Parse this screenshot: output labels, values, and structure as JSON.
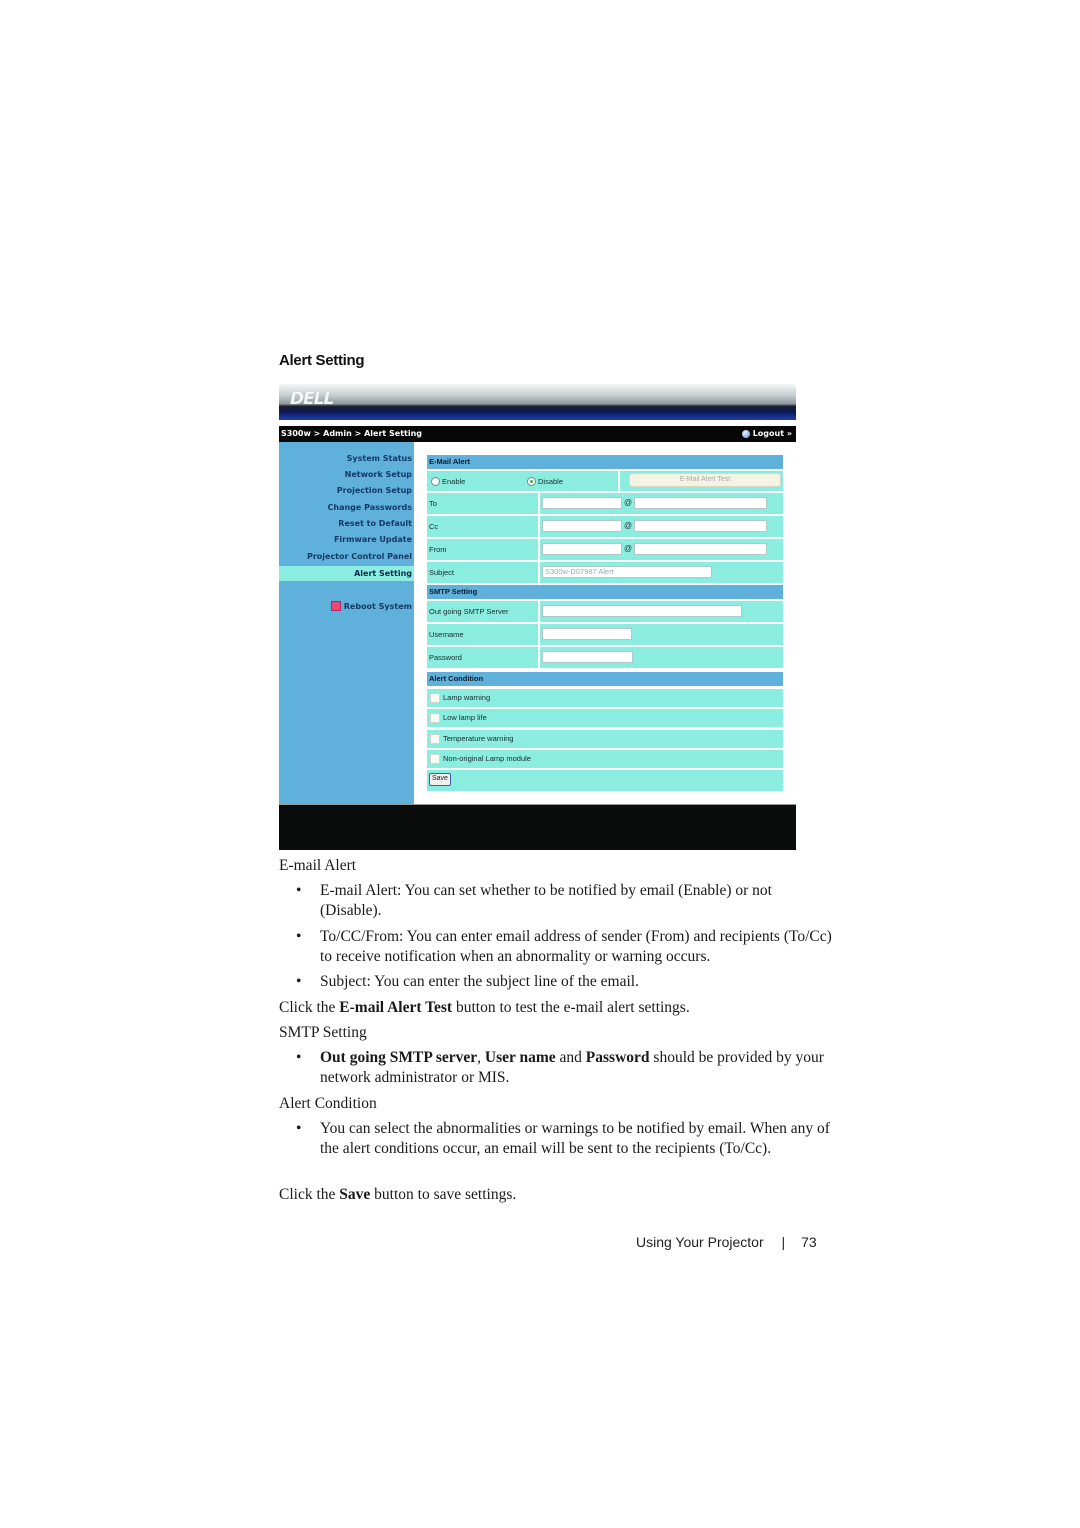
{
  "section_title": "Alert Setting",
  "ui": {
    "logo": "DELL",
    "breadcrumb": "S300w > Admin > Alert Setting",
    "logout": "Logout »",
    "sidebar": [
      "System Status",
      "Network Setup",
      "Projection Setup",
      "Change Passwords",
      "Reset to Default",
      "Firmware Update",
      "Projector Control Panel",
      "Alert Setting"
    ],
    "active_item": "Alert Setting",
    "reboot": "Reboot System",
    "email_alert": {
      "header": "E-Mail Alert",
      "enable_label": "Enable",
      "disable_label": "Disable",
      "selected": "Disable",
      "test_button": "E-Mail Alert Test",
      "to_label": "To",
      "cc_label": "Cc",
      "from_label": "From",
      "at": "@",
      "subject_label": "Subject",
      "subject_value": "S300w-D07987 Alert"
    },
    "smtp": {
      "header": "SMTP Setting",
      "server_label": "Out going SMTP Server",
      "username_label": "Username",
      "password_label": "Password"
    },
    "alert_condition": {
      "header": "Alert Condition",
      "items": [
        "Lamp warning",
        "Low lamp life",
        "Temperature warning",
        "Non-original Lamp module"
      ],
      "save": "Save"
    }
  },
  "doc": {
    "email_heading": "E-mail Alert",
    "b1": "E-mail Alert: You can set whether to be notified by email (Enable) or not (Disable).",
    "b2_bold": "To/CC/From:",
    "b2": " You can enter email address of sender (From) and recipients (To/Cc) to receive notification when an abnormality or warning occurs.",
    "b3": "Subject: You can enter the subject line of the email.",
    "click1_pre": "Click the ",
    "click1_bold": "E-mail Alert Test",
    "click1_post": " button to test the e-mail alert settings.",
    "smtp_heading": "SMTP Setting",
    "smtp_b1_bold1": "Out going SMTP server",
    "smtp_b1_sep1": ", ",
    "smtp_b1_bold2": "User name",
    "smtp_b1_sep2": " and ",
    "smtp_b1_bold3": "Password",
    "smtp_b1_post": " should be provided by your network administrator or MIS.",
    "cond_heading": "Alert Condition",
    "cond_b1": "You can select the abnormalities or warnings to be notified by email. When any of the alert conditions occur, an email will be sent to the recipients (To/Cc).",
    "click2_pre": "Click the ",
    "click2_bold": "Save",
    "click2_post": " button to save settings.",
    "bullet": "•"
  },
  "page_footer": {
    "section": "Using Your Projector",
    "separator": "|",
    "page": "73"
  }
}
